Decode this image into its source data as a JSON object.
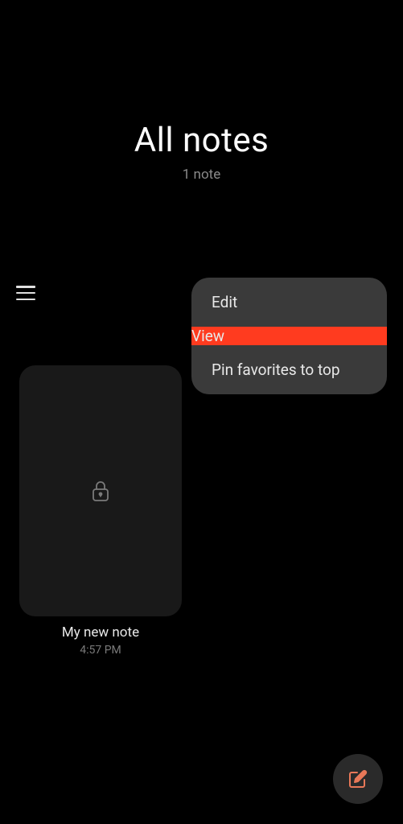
{
  "header": {
    "title": "All notes",
    "subtitle": "1 note"
  },
  "menu": {
    "items": [
      {
        "label": "Edit",
        "highlighted": false
      },
      {
        "label": "View",
        "highlighted": true
      },
      {
        "label": "Pin favorites to top",
        "highlighted": false
      }
    ]
  },
  "note": {
    "title": "My new note",
    "time": "4:57 PM",
    "locked": true
  },
  "colors": {
    "highlight": "#ff3b1f",
    "accent": "#e87858"
  }
}
